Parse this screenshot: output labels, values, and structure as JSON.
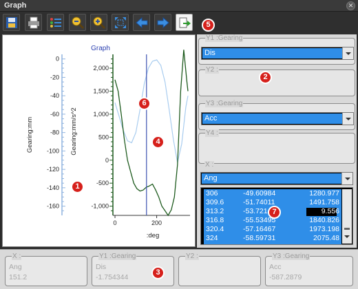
{
  "window": {
    "title": "Graph"
  },
  "toolbar": {
    "buttons": [
      "save-icon",
      "print-icon",
      "legend-icon",
      "zoom-out-icon",
      "zoom-in-icon",
      "fit-icon",
      "back-icon",
      "forward-icon",
      "export-icon"
    ]
  },
  "badges": [
    "1",
    "2",
    "3",
    "4",
    "5",
    "6",
    "7"
  ],
  "chart_data": {
    "type": "line",
    "title": "Graph",
    "xlabel": ":deg",
    "ylabel_left": "Gearing:mm",
    "ylabel_right": "Gearing:mm/s^2",
    "xlim": [
      -10,
      360
    ],
    "x_ticks": [
      "0",
      "200"
    ],
    "left_axis_ticks": [
      "0",
      "-20",
      "-40",
      "-60",
      "-80",
      "-100",
      "-120",
      "-140",
      "-160"
    ],
    "left_ylim": [
      -170,
      5
    ],
    "right_axis_ticks": [
      "2,000",
      "1,500",
      "1,000",
      "500",
      "0",
      "-500",
      "-1,000"
    ],
    "right_ylim": [
      -1200,
      2300
    ],
    "cursor_x": 151.2,
    "series": [
      {
        "name": "Dis",
        "color": "#a8ccef",
        "x": [
          0,
          20,
          40,
          60,
          80,
          100,
          120,
          140,
          160,
          180,
          200,
          220,
          240,
          260,
          280,
          300,
          320,
          340,
          350
        ],
        "y": [
          1250,
          950,
          650,
          420,
          380,
          600,
          1100,
          1650,
          2000,
          2150,
          2180,
          2060,
          1700,
          1100,
          450,
          -50,
          350,
          1150,
          1400
        ]
      },
      {
        "name": "Acc",
        "color": "#1d5a1d",
        "x": [
          0,
          15,
          30,
          45,
          60,
          75,
          90,
          105,
          120,
          135,
          150,
          165,
          180,
          195,
          210,
          225,
          240,
          255,
          270,
          285,
          300,
          315,
          330,
          345,
          350
        ],
        "y": [
          1750,
          1500,
          1000,
          450,
          0,
          -250,
          -500,
          -620,
          -670,
          -650,
          -590,
          -560,
          -520,
          -650,
          -800,
          -1000,
          -1100,
          -1200,
          -1080,
          -800,
          -100,
          1500,
          2400,
          1700,
          1500
        ]
      }
    ]
  },
  "side_panel": {
    "y1": {
      "label": "Y1 :Gearing",
      "value": "Dis"
    },
    "y2": {
      "label": "Y2 :"
    },
    "y3": {
      "label": "Y3 :Gearing",
      "value": "Acc"
    },
    "y4": {
      "label": "Y4 :"
    },
    "x": {
      "label": "X :",
      "value": "Ang",
      "rows": [
        {
          "ang": "306",
          "dis": "-49.60984",
          "acc": "1280.977"
        },
        {
          "ang": "309.6",
          "dis": "-51.74011",
          "acc": "1491.758"
        },
        {
          "ang": "313.2",
          "dis": "-53.7214",
          "acc": "9.556"
        },
        {
          "ang": "316.8",
          "dis": "-55.53495",
          "acc": "1840.826"
        },
        {
          "ang": "320.4",
          "dis": "-57.16467",
          "acc": "1973.198"
        },
        {
          "ang": "324",
          "dis": "-58.59731",
          "acc": "2075.48"
        }
      ]
    }
  },
  "readouts": [
    {
      "label": "X :",
      "name": "Ang",
      "value": "151.2"
    },
    {
      "label": "Y1 :Gearing",
      "name": "Dis",
      "value": "-1.754344"
    },
    {
      "label": "Y2 :",
      "name": "",
      "value": ""
    },
    {
      "label": "Y3 :Gearing",
      "name": "Acc",
      "value": "-587.2879"
    }
  ]
}
